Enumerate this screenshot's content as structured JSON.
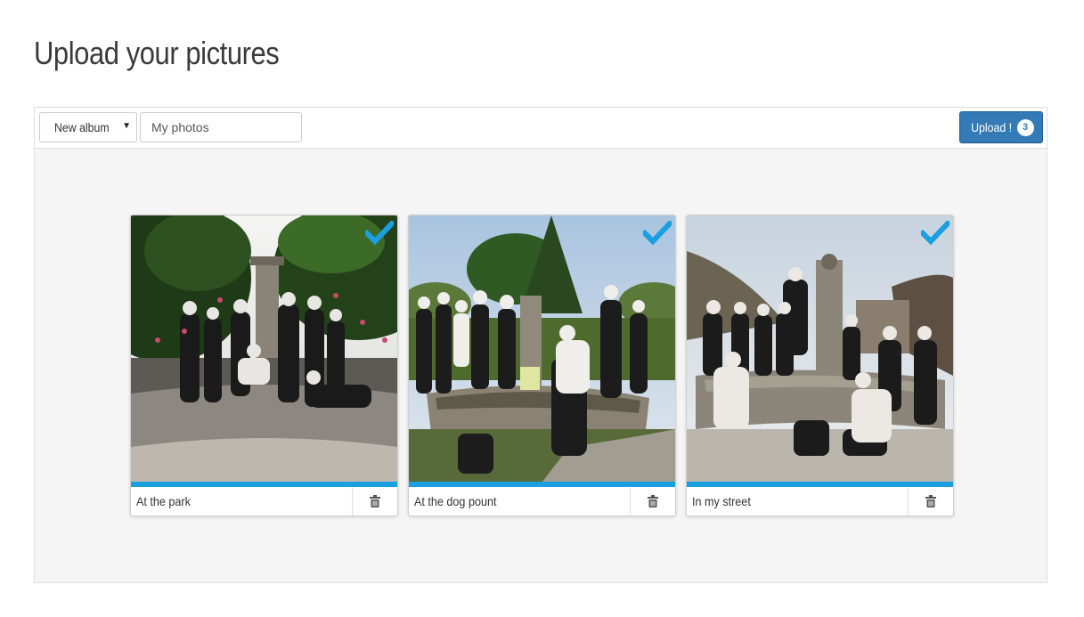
{
  "page": {
    "title": "Upload your pictures"
  },
  "toolbar": {
    "album_select": {
      "selected": "New album",
      "caret_icon": "caret-down-icon"
    },
    "album_name_input": {
      "value": "My photos"
    },
    "upload_button": {
      "label": "Upload !",
      "count": "3",
      "color": "#337ab7"
    }
  },
  "photos": [
    {
      "caption": "At the park",
      "progress": 1.0,
      "selected": true,
      "status_icon": "checkmark-icon",
      "delete_icon": "trash-icon"
    },
    {
      "caption": "At the dog pount",
      "progress": 1.0,
      "selected": true,
      "status_icon": "checkmark-icon",
      "delete_icon": "trash-icon"
    },
    {
      "caption": "In my street",
      "progress": 1.0,
      "selected": true,
      "status_icon": "checkmark-icon",
      "delete_icon": "trash-icon"
    }
  ],
  "colors": {
    "progress": "#1a9fe0",
    "check": "#1a9fe0",
    "panel_bg": "#f5f5f5"
  }
}
